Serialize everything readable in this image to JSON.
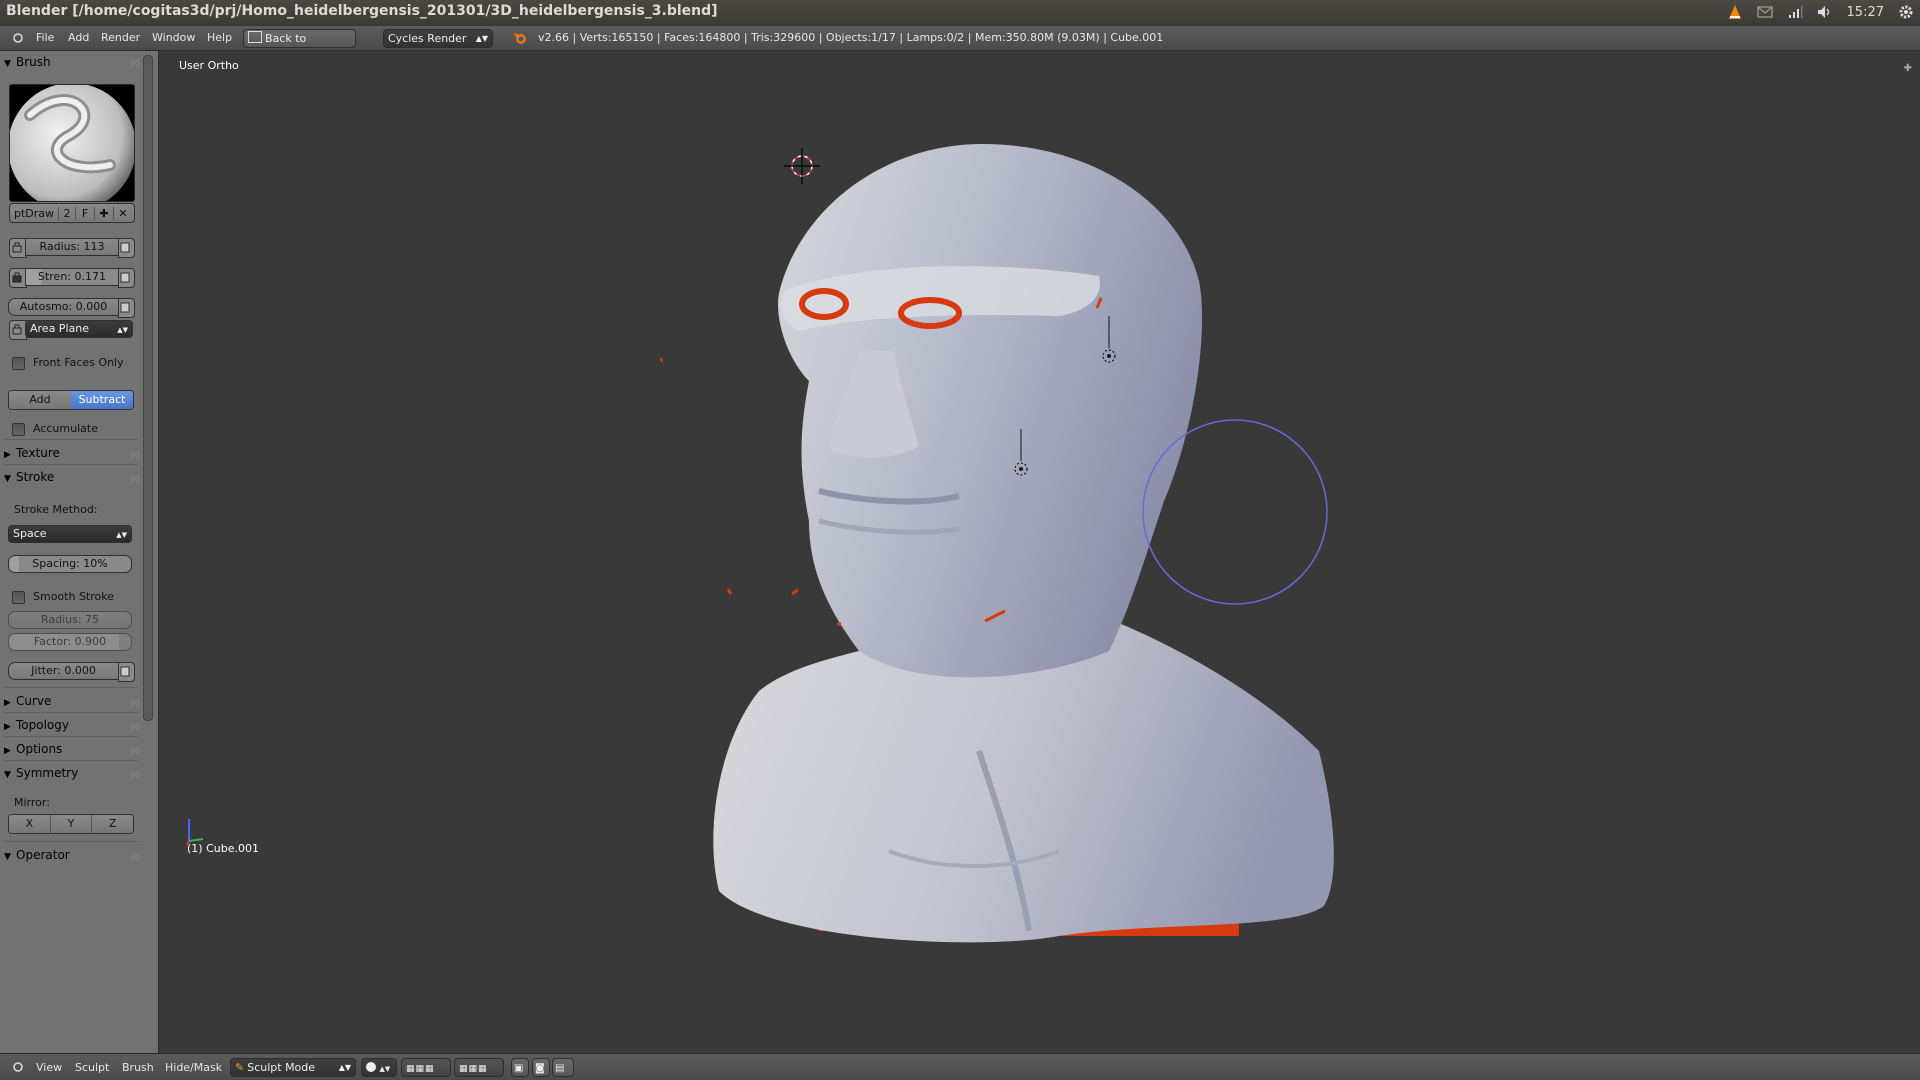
{
  "os": {
    "window_title": "Blender [/home/cogitas3d/prj/Homo_heidelbergensis_201301/3D_heidelbergensis_3.blend]",
    "clock": "15:27",
    "tray_icons": [
      "vlc-icon",
      "mail-icon",
      "network-icon",
      "volume-icon",
      "gear-icon"
    ]
  },
  "header": {
    "menus": [
      "File",
      "Add",
      "Render",
      "Window",
      "Help"
    ],
    "back_button": "Back to Previous",
    "render_engine": "Cycles Render",
    "stats": "v2.66 | Verts:165150 | Faces:164800 | Tris:329600 | Objects:1/17 | Lamps:0/2 | Mem:350.80M (9.03M) | Cube.001"
  },
  "tools": {
    "brush_section": "Brush",
    "brush_name": "ptDraw",
    "brush_users": "2",
    "brush_fake": "F",
    "radius": "Radius: 113",
    "strength": "Stren: 0.171",
    "autosmooth": "Autosmo: 0.000",
    "sculpt_plane": "Area Plane",
    "front_faces": "Front Faces Only",
    "add": "Add",
    "subtract": "Subtract",
    "accumulate": "Accumulate",
    "texture_section": "Texture",
    "stroke_section": "Stroke",
    "stroke_method_label": "Stroke Method:",
    "stroke_method": "Space",
    "spacing": "Spacing: 10%",
    "smooth_stroke": "Smooth Stroke",
    "smooth_radius": "Radius: 75",
    "smooth_factor": "Factor: 0.900",
    "jitter": "Jitter: 0.000",
    "curve_section": "Curve",
    "topology_section": "Topology",
    "options_section": "Options",
    "symmetry_section": "Symmetry",
    "mirror_label": "Mirror:",
    "mirror_axes": [
      "X",
      "Y",
      "Z"
    ],
    "operator_section": "Operator"
  },
  "viewport": {
    "view_label": "User Ortho",
    "object_label": "(1) Cube.001",
    "colors": {
      "mesh": "#bcc0d4",
      "paint": "#d83a10",
      "brush_circle": "#6a6ad8"
    }
  },
  "footer": {
    "menus": [
      "View",
      "Sculpt",
      "Brush",
      "Hide/Mask"
    ],
    "mode": "Sculpt Mode"
  }
}
